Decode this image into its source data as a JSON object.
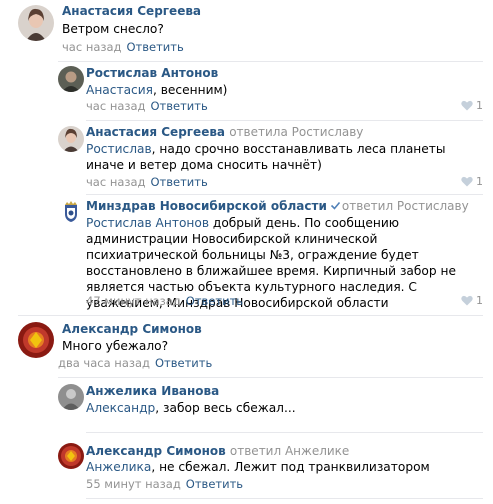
{
  "comments": [
    {
      "author": "Анастасия Сергеева",
      "reply_to": "",
      "text_mention": "",
      "text": "Ветром снесло?",
      "time": "час назад",
      "reply_label": "Ответить",
      "likes": ""
    },
    {
      "author": "Ростислав Антонов",
      "reply_to": "",
      "text_mention": "Анастасия",
      "text": ", весенним)",
      "time": "час назад",
      "reply_label": "Ответить",
      "likes": "1"
    },
    {
      "author": "Анастасия Сергеева",
      "reply_to": "ответила Ростиславу",
      "text_mention": "Ростислав",
      "text": ", надо срочно восстанавливать леса планеты иначе и ветер дома сносить начнёт)",
      "time": "час назад",
      "reply_label": "Ответить",
      "likes": "1"
    },
    {
      "author": "Минздрав Новосибирской области",
      "reply_to": "ответил Ростиславу",
      "text_mention": "Ростислав Антонов",
      "text": " добрый день. По сообщению администрации Новосибирской клинической психиатрической больницы №3, ограждение будет восстановлено в ближайшее время. Кирпичный забор не является частью объекта культурного наследия. С уважением, Минздрав Новосибирской области",
      "time": "47 минут назад",
      "reply_label": "Ответить",
      "likes": "1"
    },
    {
      "author": "Александр Симонов",
      "reply_to": "",
      "text_mention": "",
      "text": "Много убежало?",
      "time": "два часа назад",
      "reply_label": "Ответить",
      "likes": ""
    },
    {
      "author": "Анжелика Иванова",
      "reply_to": "",
      "text_mention": "Александр",
      "text": ", забор весь сбежал...",
      "time": "",
      "reply_label": "",
      "likes": ""
    },
    {
      "author": "Александр Симонов",
      "reply_to": "ответил Анжелике",
      "text_mention": "Анжелика",
      "text": ", не сбежал. Лежит под транквилизатором",
      "time": "55 минут назад",
      "reply_label": "Ответить",
      "likes": ""
    }
  ],
  "colors": {
    "link": "#2a5885",
    "muted": "#939393",
    "divider": "#e7e8ec"
  }
}
